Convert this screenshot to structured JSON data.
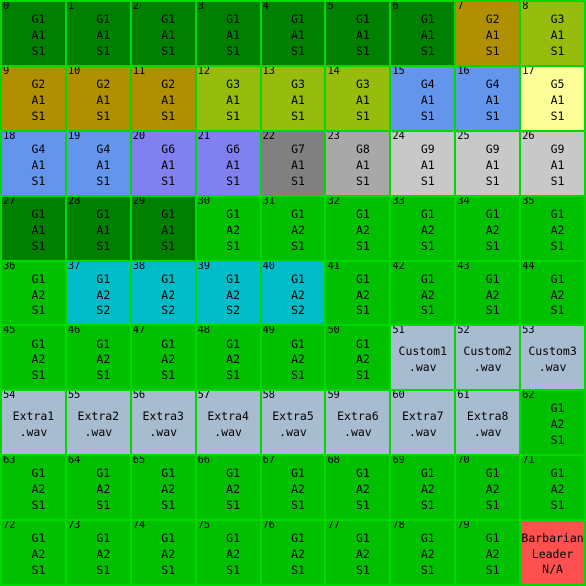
{
  "grid": {
    "columns": 9,
    "rows": 9,
    "border_color": "#00d900",
    "background_color": "#00c000",
    "text_color": "#000000",
    "palette": {
      "G1_A1_S1": "#008000",
      "G1_A2_S1": "#00c000",
      "G1_A2_S2": "#00bcc8",
      "G2_A1_S1": "#b09000",
      "G3_A1_S1": "#96bd0d",
      "G4_A1_S1": "#6495ed",
      "G5_A1_S1": "#ffff99",
      "G6_A1_S1": "#8080f0",
      "G7_A1_S1": "#808080",
      "G8_A1_S1": "#a8a8a8",
      "G9_A1_S1": "#c8c8c8",
      "wav": "#a8bcd0",
      "barbarian": "#ff5050"
    },
    "cells": [
      {
        "index": "0",
        "lines": [
          "G1",
          "A1",
          "S1"
        ],
        "color": "#008000",
        "kind": "preset"
      },
      {
        "index": "1",
        "lines": [
          "G1",
          "A1",
          "S1"
        ],
        "color": "#008000",
        "kind": "preset"
      },
      {
        "index": "2",
        "lines": [
          "G1",
          "A1",
          "S1"
        ],
        "color": "#008000",
        "kind": "preset"
      },
      {
        "index": "3",
        "lines": [
          "G1",
          "A1",
          "S1"
        ],
        "color": "#008000",
        "kind": "preset"
      },
      {
        "index": "4",
        "lines": [
          "G1",
          "A1",
          "S1"
        ],
        "color": "#008000",
        "kind": "preset"
      },
      {
        "index": "5",
        "lines": [
          "G1",
          "A1",
          "S1"
        ],
        "color": "#008000",
        "kind": "preset"
      },
      {
        "index": "6",
        "lines": [
          "G1",
          "A1",
          "S1"
        ],
        "color": "#008000",
        "kind": "preset"
      },
      {
        "index": "7",
        "lines": [
          "G2",
          "A1",
          "S1"
        ],
        "color": "#b09000",
        "kind": "preset"
      },
      {
        "index": "8",
        "lines": [
          "G3",
          "A1",
          "S1"
        ],
        "color": "#96bd0d",
        "kind": "preset"
      },
      {
        "index": "9",
        "lines": [
          "G2",
          "A1",
          "S1"
        ],
        "color": "#b09000",
        "kind": "preset"
      },
      {
        "index": "10",
        "lines": [
          "G2",
          "A1",
          "S1"
        ],
        "color": "#b09000",
        "kind": "preset"
      },
      {
        "index": "11",
        "lines": [
          "G2",
          "A1",
          "S1"
        ],
        "color": "#b09000",
        "kind": "preset"
      },
      {
        "index": "12",
        "lines": [
          "G3",
          "A1",
          "S1"
        ],
        "color": "#96bd0d",
        "kind": "preset"
      },
      {
        "index": "13",
        "lines": [
          "G3",
          "A1",
          "S1"
        ],
        "color": "#96bd0d",
        "kind": "preset"
      },
      {
        "index": "14",
        "lines": [
          "G3",
          "A1",
          "S1"
        ],
        "color": "#96bd0d",
        "kind": "preset"
      },
      {
        "index": "15",
        "lines": [
          "G4",
          "A1",
          "S1"
        ],
        "color": "#6495ed",
        "kind": "preset"
      },
      {
        "index": "16",
        "lines": [
          "G4",
          "A1",
          "S1"
        ],
        "color": "#6495ed",
        "kind": "preset"
      },
      {
        "index": "17",
        "lines": [
          "G5",
          "A1",
          "S1"
        ],
        "color": "#ffff99",
        "kind": "preset"
      },
      {
        "index": "18",
        "lines": [
          "G4",
          "A1",
          "S1"
        ],
        "color": "#6495ed",
        "kind": "preset"
      },
      {
        "index": "19",
        "lines": [
          "G4",
          "A1",
          "S1"
        ],
        "color": "#6495ed",
        "kind": "preset"
      },
      {
        "index": "20",
        "lines": [
          "G6",
          "A1",
          "S1"
        ],
        "color": "#8080f0",
        "kind": "preset"
      },
      {
        "index": "21",
        "lines": [
          "G6",
          "A1",
          "S1"
        ],
        "color": "#8080f0",
        "kind": "preset"
      },
      {
        "index": "22",
        "lines": [
          "G7",
          "A1",
          "S1"
        ],
        "color": "#808080",
        "kind": "preset"
      },
      {
        "index": "23",
        "lines": [
          "G8",
          "A1",
          "S1"
        ],
        "color": "#a8a8a8",
        "kind": "preset"
      },
      {
        "index": "24",
        "lines": [
          "G9",
          "A1",
          "S1"
        ],
        "color": "#c8c8c8",
        "kind": "preset"
      },
      {
        "index": "25",
        "lines": [
          "G9",
          "A1",
          "S1"
        ],
        "color": "#c8c8c8",
        "kind": "preset"
      },
      {
        "index": "26",
        "lines": [
          "G9",
          "A1",
          "S1"
        ],
        "color": "#c8c8c8",
        "kind": "preset"
      },
      {
        "index": "27",
        "lines": [
          "G1",
          "A1",
          "S1"
        ],
        "color": "#008000",
        "kind": "preset"
      },
      {
        "index": "28",
        "lines": [
          "G1",
          "A1",
          "S1"
        ],
        "color": "#008000",
        "kind": "preset"
      },
      {
        "index": "29",
        "lines": [
          "G1",
          "A1",
          "S1"
        ],
        "color": "#008000",
        "kind": "preset"
      },
      {
        "index": "30",
        "lines": [
          "G1",
          "A2",
          "S1"
        ],
        "color": "#00c000",
        "kind": "preset"
      },
      {
        "index": "31",
        "lines": [
          "G1",
          "A2",
          "S1"
        ],
        "color": "#00c000",
        "kind": "preset"
      },
      {
        "index": "32",
        "lines": [
          "G1",
          "A2",
          "S1"
        ],
        "color": "#00c000",
        "kind": "preset"
      },
      {
        "index": "33",
        "lines": [
          "G1",
          "A2",
          "S1"
        ],
        "color": "#00c000",
        "kind": "preset"
      },
      {
        "index": "34",
        "lines": [
          "G1",
          "A2",
          "S1"
        ],
        "color": "#00c000",
        "kind": "preset"
      },
      {
        "index": "35",
        "lines": [
          "G1",
          "A2",
          "S1"
        ],
        "color": "#00c000",
        "kind": "preset"
      },
      {
        "index": "36",
        "lines": [
          "G1",
          "A2",
          "S1"
        ],
        "color": "#00c000",
        "kind": "preset"
      },
      {
        "index": "37",
        "lines": [
          "G1",
          "A2",
          "S2"
        ],
        "color": "#00bcc8",
        "kind": "preset"
      },
      {
        "index": "38",
        "lines": [
          "G1",
          "A2",
          "S2"
        ],
        "color": "#00bcc8",
        "kind": "preset"
      },
      {
        "index": "39",
        "lines": [
          "G1",
          "A2",
          "S2"
        ],
        "color": "#00bcc8",
        "kind": "preset"
      },
      {
        "index": "40",
        "lines": [
          "G1",
          "A2",
          "S2"
        ],
        "color": "#00bcc8",
        "kind": "preset"
      },
      {
        "index": "41",
        "lines": [
          "G1",
          "A2",
          "S1"
        ],
        "color": "#00c000",
        "kind": "preset"
      },
      {
        "index": "42",
        "lines": [
          "G1",
          "A2",
          "S1"
        ],
        "color": "#00c000",
        "kind": "preset"
      },
      {
        "index": "43",
        "lines": [
          "G1",
          "A2",
          "S1"
        ],
        "color": "#00c000",
        "kind": "preset"
      },
      {
        "index": "44",
        "lines": [
          "G1",
          "A2",
          "S1"
        ],
        "color": "#00c000",
        "kind": "preset"
      },
      {
        "index": "45",
        "lines": [
          "G1",
          "A2",
          "S1"
        ],
        "color": "#00c000",
        "kind": "preset"
      },
      {
        "index": "46",
        "lines": [
          "G1",
          "A2",
          "S1"
        ],
        "color": "#00c000",
        "kind": "preset"
      },
      {
        "index": "47",
        "lines": [
          "G1",
          "A2",
          "S1"
        ],
        "color": "#00c000",
        "kind": "preset"
      },
      {
        "index": "48",
        "lines": [
          "G1",
          "A2",
          "S1"
        ],
        "color": "#00c000",
        "kind": "preset"
      },
      {
        "index": "49",
        "lines": [
          "G1",
          "A2",
          "S1"
        ],
        "color": "#00c000",
        "kind": "preset"
      },
      {
        "index": "50",
        "lines": [
          "G1",
          "A2",
          "S1"
        ],
        "color": "#00c000",
        "kind": "preset"
      },
      {
        "index": "51",
        "lines": [
          "Custom1",
          ".wav"
        ],
        "color": "#a8bcd0",
        "kind": "wav"
      },
      {
        "index": "52",
        "lines": [
          "Custom2",
          ".wav"
        ],
        "color": "#a8bcd0",
        "kind": "wav"
      },
      {
        "index": "53",
        "lines": [
          "Custom3",
          ".wav"
        ],
        "color": "#a8bcd0",
        "kind": "wav"
      },
      {
        "index": "54",
        "lines": [
          "Extra1",
          ".wav"
        ],
        "color": "#a8bcd0",
        "kind": "wav"
      },
      {
        "index": "55",
        "lines": [
          "Extra2",
          ".wav"
        ],
        "color": "#a8bcd0",
        "kind": "wav"
      },
      {
        "index": "56",
        "lines": [
          "Extra3",
          ".wav"
        ],
        "color": "#a8bcd0",
        "kind": "wav"
      },
      {
        "index": "57",
        "lines": [
          "Extra4",
          ".wav"
        ],
        "color": "#a8bcd0",
        "kind": "wav"
      },
      {
        "index": "58",
        "lines": [
          "Extra5",
          ".wav"
        ],
        "color": "#a8bcd0",
        "kind": "wav"
      },
      {
        "index": "59",
        "lines": [
          "Extra6",
          ".wav"
        ],
        "color": "#a8bcd0",
        "kind": "wav"
      },
      {
        "index": "60",
        "lines": [
          "Extra7",
          ".wav"
        ],
        "color": "#a8bcd0",
        "kind": "wav"
      },
      {
        "index": "61",
        "lines": [
          "Extra8",
          ".wav"
        ],
        "color": "#a8bcd0",
        "kind": "wav"
      },
      {
        "index": "62",
        "lines": [
          "G1",
          "A2",
          "S1"
        ],
        "color": "#00c000",
        "kind": "preset"
      },
      {
        "index": "63",
        "lines": [
          "G1",
          "A2",
          "S1"
        ],
        "color": "#00c000",
        "kind": "preset"
      },
      {
        "index": "64",
        "lines": [
          "G1",
          "A2",
          "S1"
        ],
        "color": "#00c000",
        "kind": "preset"
      },
      {
        "index": "65",
        "lines": [
          "G1",
          "A2",
          "S1"
        ],
        "color": "#00c000",
        "kind": "preset"
      },
      {
        "index": "66",
        "lines": [
          "G1",
          "A2",
          "S1"
        ],
        "color": "#00c000",
        "kind": "preset"
      },
      {
        "index": "67",
        "lines": [
          "G1",
          "A2",
          "S1"
        ],
        "color": "#00c000",
        "kind": "preset"
      },
      {
        "index": "68",
        "lines": [
          "G1",
          "A2",
          "S1"
        ],
        "color": "#00c000",
        "kind": "preset"
      },
      {
        "index": "69",
        "lines": [
          "G1",
          "A2",
          "S1"
        ],
        "color": "#00c000",
        "kind": "preset"
      },
      {
        "index": "70",
        "lines": [
          "G1",
          "A2",
          "S1"
        ],
        "color": "#00c000",
        "kind": "preset"
      },
      {
        "index": "71",
        "lines": [
          "G1",
          "A2",
          "S1"
        ],
        "color": "#00c000",
        "kind": "preset"
      },
      {
        "index": "72",
        "lines": [
          "G1",
          "A2",
          "S1"
        ],
        "color": "#00c000",
        "kind": "preset"
      },
      {
        "index": "73",
        "lines": [
          "G1",
          "A2",
          "S1"
        ],
        "color": "#00c000",
        "kind": "preset"
      },
      {
        "index": "74",
        "lines": [
          "G1",
          "A2",
          "S1"
        ],
        "color": "#00c000",
        "kind": "preset"
      },
      {
        "index": "75",
        "lines": [
          "G1",
          "A2",
          "S1"
        ],
        "color": "#00c000",
        "kind": "preset"
      },
      {
        "index": "76",
        "lines": [
          "G1",
          "A2",
          "S1"
        ],
        "color": "#00c000",
        "kind": "preset"
      },
      {
        "index": "77",
        "lines": [
          "G1",
          "A2",
          "S1"
        ],
        "color": "#00c000",
        "kind": "preset"
      },
      {
        "index": "78",
        "lines": [
          "G1",
          "A2",
          "S1"
        ],
        "color": "#00c000",
        "kind": "preset"
      },
      {
        "index": "79",
        "lines": [
          "G1",
          "A2",
          "S1"
        ],
        "color": "#00c000",
        "kind": "preset"
      },
      {
        "index": "",
        "lines": [
          "Barbarian",
          "Leader",
          "N/A"
        ],
        "color": "#ff5050",
        "kind": "special"
      }
    ]
  }
}
